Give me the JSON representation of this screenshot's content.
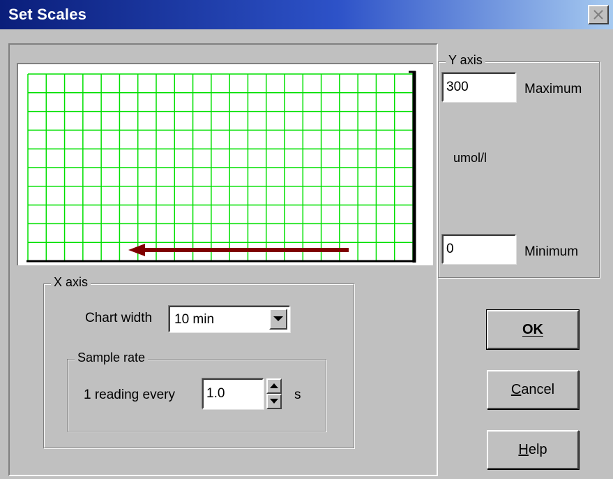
{
  "window": {
    "title": "Set Scales"
  },
  "y_axis": {
    "legend": "Y axis",
    "maximum_value": "300",
    "maximum_label": "Maximum",
    "unit": "umol/l",
    "minimum_value": "0",
    "minimum_label": "Minimum"
  },
  "x_axis": {
    "legend": "X axis",
    "chart_width_label": "Chart width",
    "chart_width_value": "10 min",
    "sample_rate": {
      "legend": "Sample rate",
      "prefix_label": "1 reading every",
      "value": "1.0",
      "unit": "s"
    }
  },
  "buttons": {
    "ok": "OK",
    "cancel": "Cancel",
    "help": "Help"
  },
  "colors": {
    "grid": "#00e000",
    "arrow": "#800000",
    "axis": "#000000"
  },
  "icons": {
    "close": "close-icon",
    "dropdown": "chevron-down-icon",
    "spin_up": "arrow-up-icon",
    "spin_down": "arrow-down-icon"
  }
}
